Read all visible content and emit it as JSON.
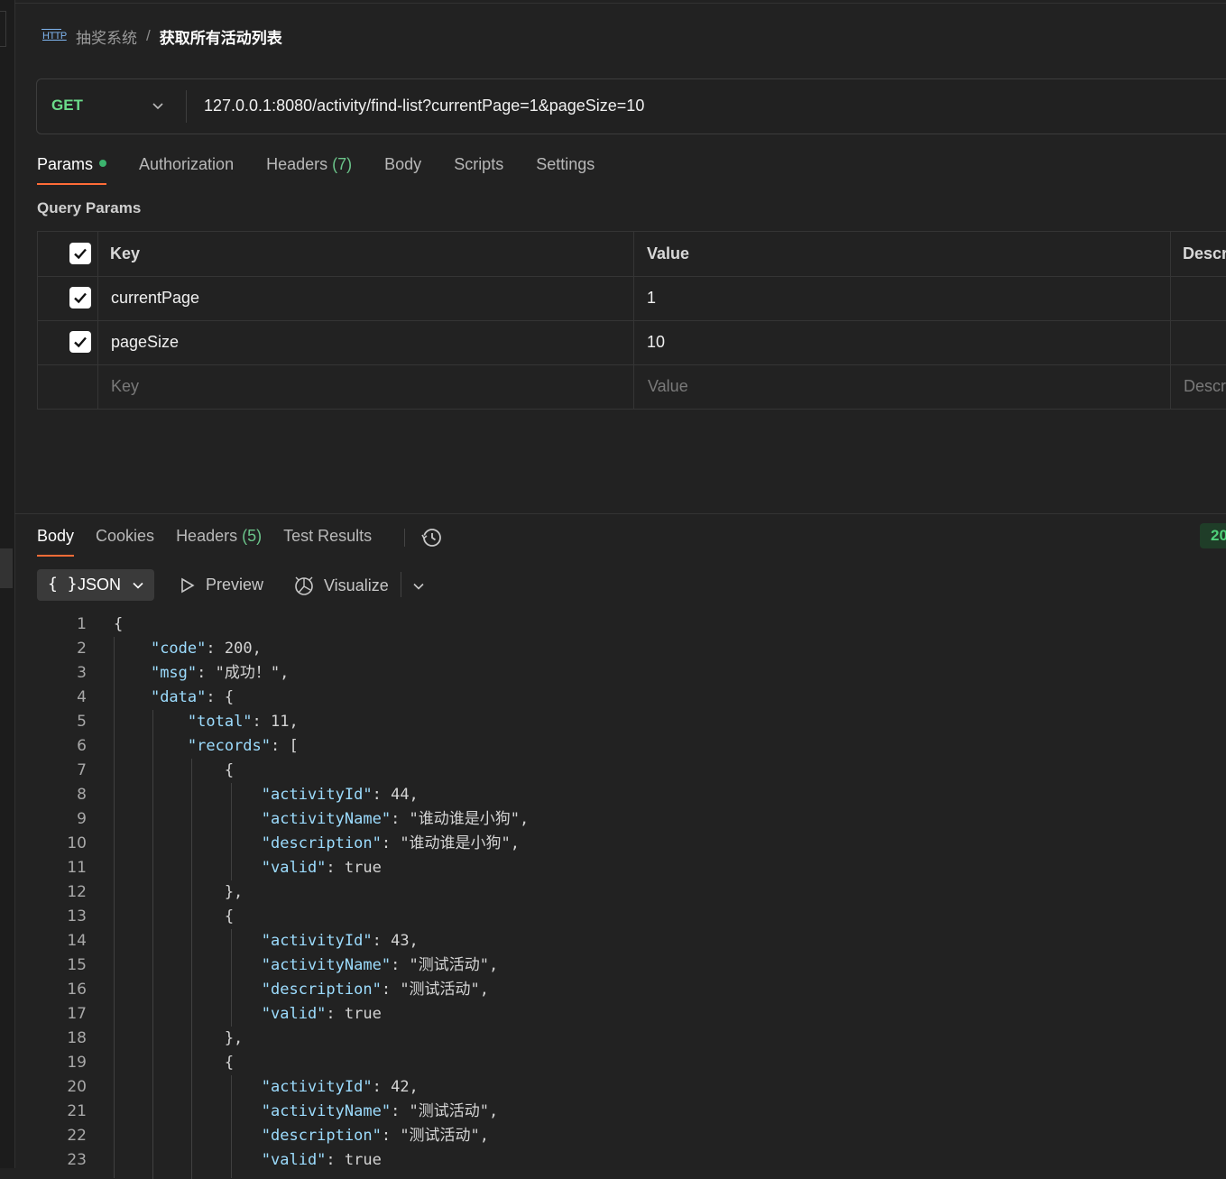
{
  "header": {
    "icon": "http-icon",
    "icon_text": "HTTP",
    "collection": "抽奖系统",
    "separator": "/",
    "request_name": "获取所有活动列表"
  },
  "request": {
    "method": "GET",
    "url": "127.0.0.1:8080/activity/find-list?currentPage=1&pageSize=10"
  },
  "request_tabs": [
    {
      "label": "Params",
      "active": true,
      "dot": true
    },
    {
      "label": "Authorization"
    },
    {
      "label": "Headers",
      "count": "(7)"
    },
    {
      "label": "Body"
    },
    {
      "label": "Scripts"
    },
    {
      "label": "Settings"
    }
  ],
  "query_params": {
    "title": "Query Params",
    "headers": {
      "key": "Key",
      "value": "Value",
      "description": "Descr"
    },
    "rows": [
      {
        "checked": true,
        "key": "currentPage",
        "value": "1"
      },
      {
        "checked": true,
        "key": "pageSize",
        "value": "10"
      }
    ],
    "placeholder": {
      "key": "Key",
      "value": "Value",
      "description": "Descr"
    }
  },
  "response": {
    "tabs": [
      {
        "label": "Body",
        "active": true
      },
      {
        "label": "Cookies"
      },
      {
        "label": "Headers",
        "count": "(5)"
      },
      {
        "label": "Test Results"
      }
    ],
    "status_badge": "20",
    "format": "JSON",
    "format_braces": "{ }",
    "preview_label": "Preview",
    "visualize_label": "Visualize"
  },
  "code_lines": [
    {
      "n": "1",
      "t": "{"
    },
    {
      "n": "2",
      "t": "    \"code\": 200,"
    },
    {
      "n": "3",
      "t": "    \"msg\": \"成功！\","
    },
    {
      "n": "4",
      "t": "    \"data\": {"
    },
    {
      "n": "5",
      "t": "        \"total\": 11,"
    },
    {
      "n": "6",
      "t": "        \"records\": ["
    },
    {
      "n": "7",
      "t": "            {"
    },
    {
      "n": "8",
      "t": "                \"activityId\": 44,"
    },
    {
      "n": "9",
      "t": "                \"activityName\": \"谁动谁是小狗\","
    },
    {
      "n": "10",
      "t": "                \"description\": \"谁动谁是小狗\","
    },
    {
      "n": "11",
      "t": "                \"valid\": true"
    },
    {
      "n": "12",
      "t": "            },"
    },
    {
      "n": "13",
      "t": "            {"
    },
    {
      "n": "14",
      "t": "                \"activityId\": 43,"
    },
    {
      "n": "15",
      "t": "                \"activityName\": \"测试活动\","
    },
    {
      "n": "16",
      "t": "                \"description\": \"测试活动\","
    },
    {
      "n": "17",
      "t": "                \"valid\": true"
    },
    {
      "n": "18",
      "t": "            },"
    },
    {
      "n": "19",
      "t": "            {"
    },
    {
      "n": "20",
      "t": "                \"activityId\": 42,"
    },
    {
      "n": "21",
      "t": "                \"activityName\": \"测试活动\","
    },
    {
      "n": "22",
      "t": "                \"description\": \"测试活动\","
    },
    {
      "n": "23",
      "t": "                \"valid\": true"
    }
  ],
  "colors": {
    "accent": "#ff6c37",
    "method_get": "#6bdc8a",
    "json_key": "#9cdcfe",
    "json_string": "#ce9178",
    "json_number": "#b5cea8"
  }
}
